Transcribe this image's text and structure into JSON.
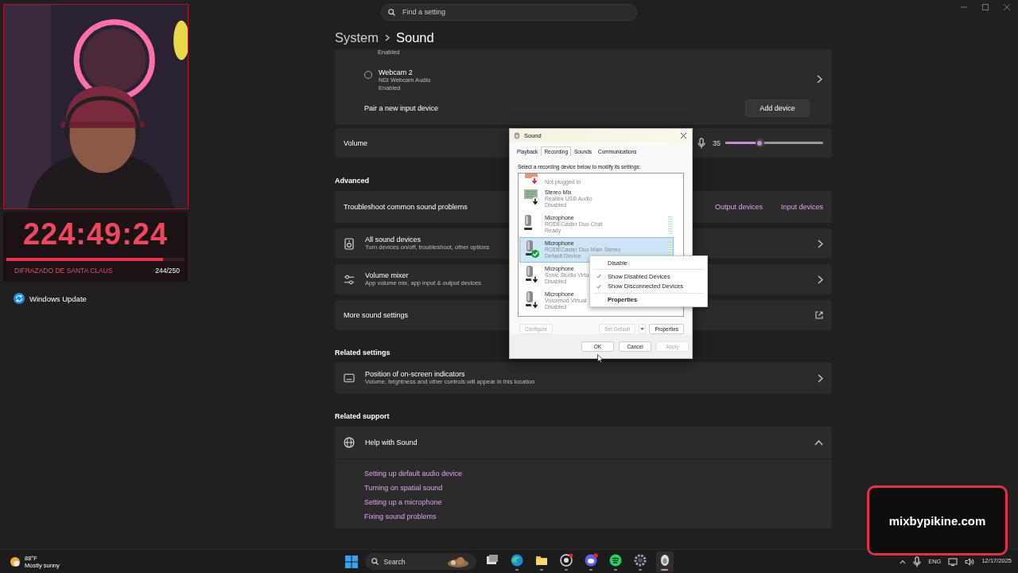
{
  "search": {
    "placeholder": "Find a setting"
  },
  "breadcrumb": {
    "parent": "System",
    "current": "Sound"
  },
  "sidebar": {
    "items": [
      {
        "label": "Windows Update"
      }
    ]
  },
  "stream_overlay": {
    "timer": "224:49:24",
    "level": 0.88,
    "goal": "DIFRAZADO DE SANTA CLAUS",
    "count": "244/250",
    "site": "mixbypikine.com"
  },
  "input_devices": {
    "partial_status": "Enabled",
    "devices": [
      {
        "name": "Webcam 2",
        "driver": "NDI Webcam Audio",
        "status": "Enabled",
        "selected": false
      }
    ],
    "pair": {
      "label": "Pair a new input device",
      "button": "Add device"
    }
  },
  "volume": {
    "label": "Volume",
    "reading": "35",
    "level": 0.35
  },
  "advanced": {
    "heading": "Advanced",
    "troubleshoot": {
      "label": "Troubleshoot common sound problems",
      "links": [
        "Output devices",
        "Input devices"
      ]
    },
    "items": [
      {
        "kind": "devices",
        "title": "All sound devices",
        "subtitle": "Turn devices on/off, troubleshoot, other options"
      },
      {
        "kind": "mixer",
        "title": "Volume mixer",
        "subtitle": "App volume mix, app input & output devices"
      },
      {
        "kind": "external",
        "title": "More sound settings"
      }
    ]
  },
  "related_settings": {
    "heading": "Related settings",
    "items": [
      {
        "kind": "display",
        "title": "Position of on-screen indicators",
        "subtitle": "Volume, brightness and other controls will appear in this location"
      }
    ]
  },
  "related_support": {
    "heading": "Related support",
    "section": {
      "title": "Help with Sound",
      "expanded": true,
      "links": [
        "Setting up default audio device",
        "Turning on spatial sound",
        "Setting up a microphone",
        "Fixing sound problems"
      ]
    }
  },
  "dialog": {
    "title": "Sound",
    "tabs": [
      {
        "label": "Playback",
        "selected": false
      },
      {
        "label": "Recording",
        "selected": true
      },
      {
        "label": "Sounds",
        "selected": false
      },
      {
        "label": "Communications",
        "selected": false
      }
    ],
    "instruction": "Select a recording device below to modify its settings:",
    "devices": [
      {
        "kind": "usb",
        "status": "Not plugged in",
        "disabled": false,
        "default": false,
        "meter": false,
        "selected": false
      },
      {
        "kind": "board",
        "name": "Stereo Mix",
        "driver": "Realtek USB Audio",
        "status": "Disabled",
        "disabled": true,
        "default": false,
        "meter": false,
        "selected": false
      },
      {
        "kind": "mic",
        "name": "Microphone",
        "driver": "RODECaster Duo Chat",
        "status": "Ready",
        "disabled": false,
        "default": false,
        "meter": true,
        "selected": false
      },
      {
        "kind": "mic",
        "name": "Microphone",
        "driver": "RODECaster Duo Main Stereo",
        "status": "Default Device",
        "disabled": false,
        "default": true,
        "meter": true,
        "selected": true
      },
      {
        "kind": "mic",
        "name": "Microphone",
        "driver": "Sonic Studio Virtu",
        "status": "Disabled",
        "disabled": true,
        "default": false,
        "meter": false,
        "selected": false
      },
      {
        "kind": "mic",
        "name": "Microphone",
        "driver": "Voicemod Virtual",
        "status": "Disabled",
        "disabled": true,
        "default": false,
        "meter": false,
        "selected": false
      }
    ],
    "device_buttons": [
      {
        "label": "Configure",
        "disabled": true
      },
      {
        "label": "Set Default",
        "disabled": true
      },
      {
        "label": "Properties",
        "disabled": false
      }
    ],
    "actions": [
      {
        "label": "OK",
        "disabled": false
      },
      {
        "label": "Cancel",
        "disabled": false
      },
      {
        "label": "Apply",
        "disabled": true
      }
    ]
  },
  "context_menu": {
    "items": [
      {
        "kind": "action",
        "label": "Disable",
        "checked": false
      },
      {
        "kind": "toggle",
        "label": "Show Disabled Devices",
        "checked": true
      },
      {
        "kind": "toggle",
        "label": "Show Disconnected Devices",
        "checked": true
      },
      {
        "kind": "default",
        "label": "Properties",
        "checked": false
      }
    ]
  },
  "taskbar": {
    "weather": {
      "temp": "88°F",
      "condition": "Mostly sunny"
    },
    "search": "Search",
    "apps": [
      {
        "kind": "task-view",
        "running": false,
        "active": false
      },
      {
        "kind": "browser",
        "running": true,
        "active": false
      },
      {
        "kind": "folder",
        "running": true,
        "active": false
      },
      {
        "kind": "camera",
        "running": true,
        "active": false
      },
      {
        "kind": "chat",
        "running": true,
        "active": false
      },
      {
        "kind": "music",
        "running": true,
        "active": false
      },
      {
        "kind": "gear",
        "running": true,
        "active": false
      },
      {
        "kind": "speaker",
        "running": true,
        "active": true
      }
    ],
    "language": "ENG",
    "date": "12/17/2025"
  }
}
